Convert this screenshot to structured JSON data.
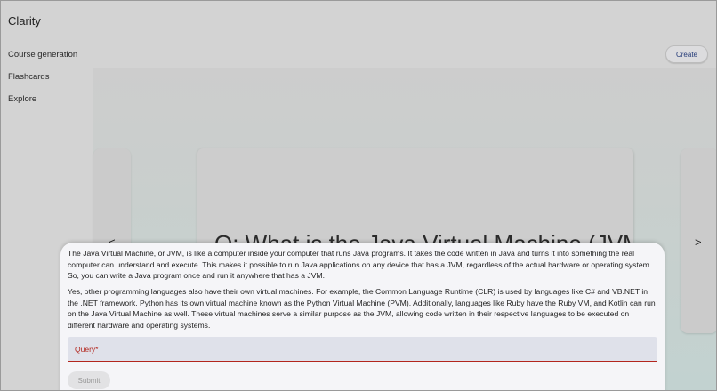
{
  "app": {
    "title": "Clarity"
  },
  "sidebar": {
    "items": [
      {
        "label": "Course generation"
      },
      {
        "label": "Flashcards"
      },
      {
        "label": "Explore"
      }
    ]
  },
  "header": {
    "create_label": "Create"
  },
  "carousel": {
    "question": "Q: What is the Java Virtual Machine (JVM)?",
    "prev_glyph": "<",
    "next_glyph": ">"
  },
  "answer_sheet": {
    "paragraphs": [
      "The Java Virtual Machine, or JVM, is like a computer inside your computer that runs Java programs. It takes the code written in Java and turns it into something the real computer can understand and execute. This makes it possible to run Java applications on any device that has a JVM, regardless of the actual hardware or operating system. So, you can write a Java program once and run it anywhere that has a JVM.",
      "Yes, other programming languages also have their own virtual machines. For example, the Common Language Runtime (CLR) is used by languages like C# and VB.NET in the .NET framework. Python has its own virtual machine known as the Python Virtual Machine (PVM). Additionally, languages like Ruby have the Ruby VM, and Kotlin can run on the Java Virtual Machine as well. These virtual machines serve a similar purpose as the JVM, allowing code written in their respective languages to be executed on different hardware and operating systems."
    ],
    "query_label": "Query*",
    "submit_label": "Submit"
  },
  "colors": {
    "accent": "#243a78",
    "error": "#b3261e",
    "sheet_bg": "#f5f5f8"
  }
}
